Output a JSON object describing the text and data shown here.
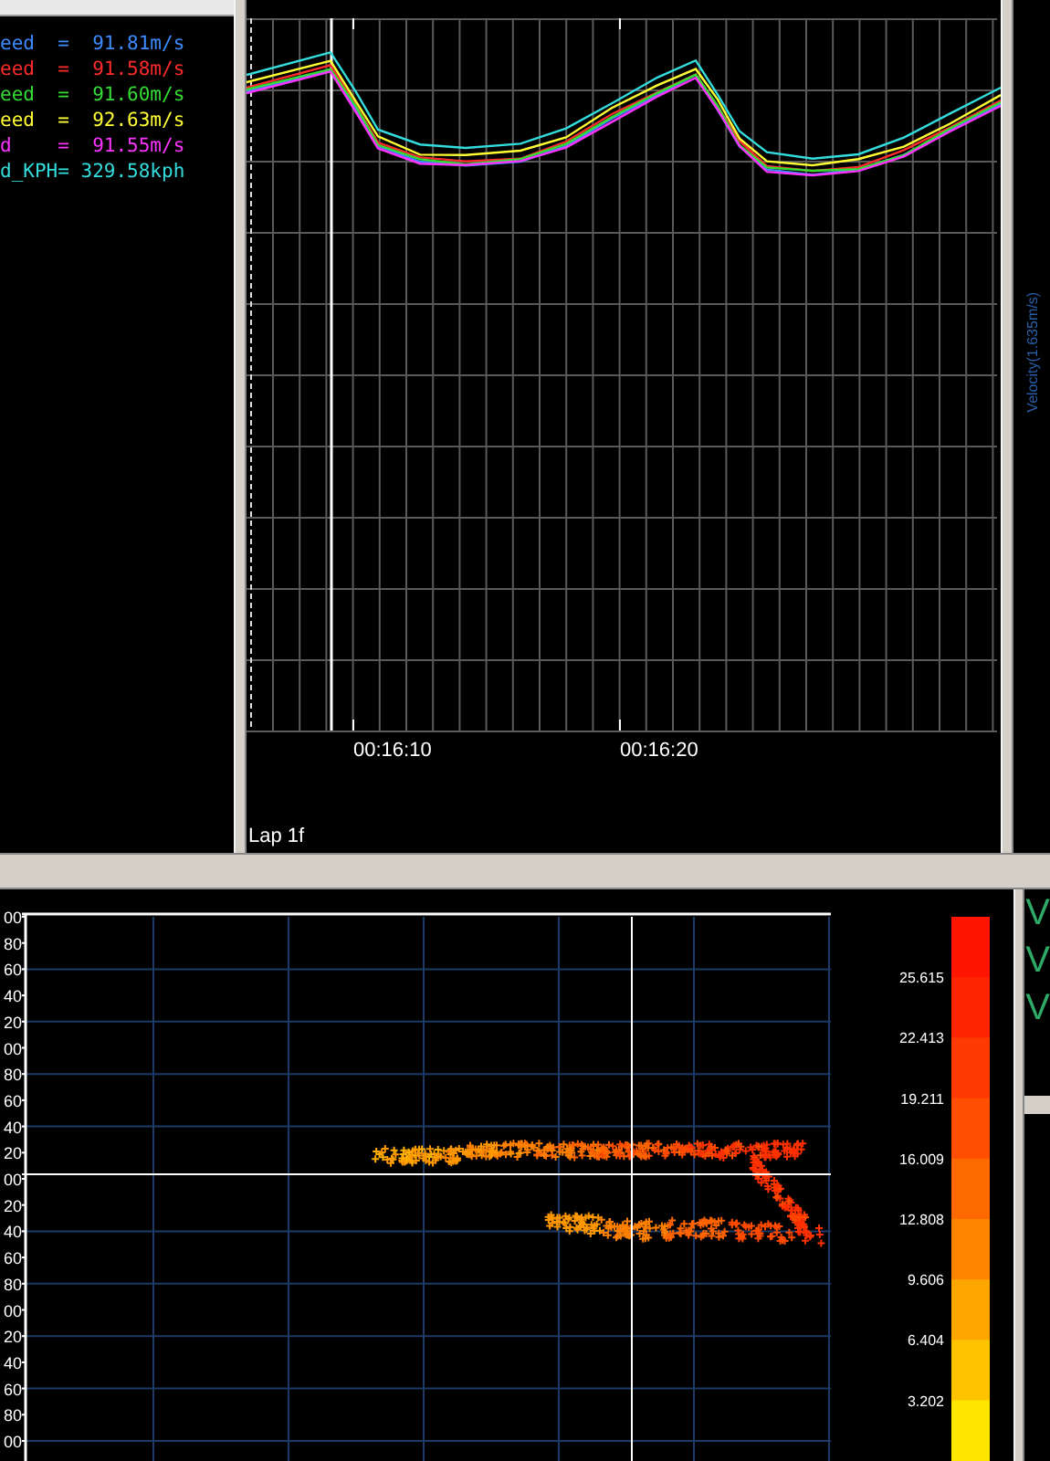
{
  "index_panel": {
    "legend": [
      {
        "text": "eed  =  91.81m/s",
        "color": "#3c8cff"
      },
      {
        "text": "eed  =  91.58m/s",
        "color": "#ff2a2a"
      },
      {
        "text": "eed  =  91.60m/s",
        "color": "#33dd33"
      },
      {
        "text": "eed  =  92.63m/s",
        "color": "#ffff33"
      },
      {
        "text": "d    =  91.55m/s",
        "color": "#ff33ff"
      },
      {
        "text": "d_KPH= 329.58kph",
        "color": "#33dddd"
      }
    ]
  },
  "time_chart": {
    "time_labels": [
      "00:16:10",
      "00:16:20"
    ],
    "lap_label": "Lap 1f",
    "side_label": "Velocity(1.635m/s)"
  },
  "scatter": {
    "y_labels": [
      "00",
      "80",
      "60",
      "40",
      "20",
      "00",
      "80",
      "60",
      "40",
      "20",
      "00",
      "20",
      "40",
      "60",
      "80",
      "00",
      "20",
      "40",
      "60",
      "80",
      "00"
    ],
    "scale_labels": [
      "25.615",
      "22.413",
      "19.211",
      "16.009",
      "12.808",
      "9.606",
      "6.404",
      "3.202"
    ]
  },
  "side_panel": {
    "labels": [
      "V",
      "V",
      "V"
    ]
  }
}
